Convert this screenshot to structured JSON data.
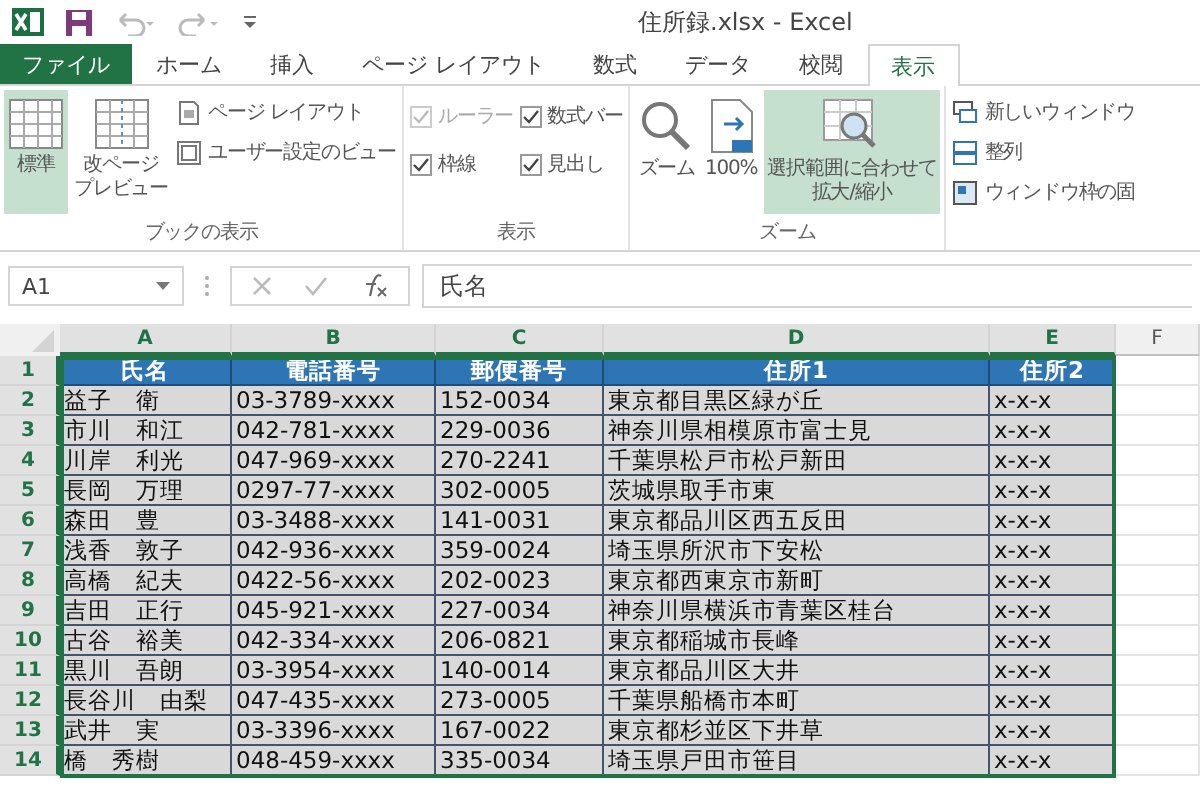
{
  "window": {
    "title": "住所録.xlsx - Excel"
  },
  "tabs": [
    {
      "label": "ファイル",
      "kind": "file",
      "selected": false
    },
    {
      "label": "ホーム",
      "kind": "tab",
      "selected": false
    },
    {
      "label": "挿入",
      "kind": "tab",
      "selected": false
    },
    {
      "label": "ページ レイアウト",
      "kind": "tab",
      "selected": false
    },
    {
      "label": "数式",
      "kind": "tab",
      "selected": false
    },
    {
      "label": "データ",
      "kind": "tab",
      "selected": false
    },
    {
      "label": "校閲",
      "kind": "tab",
      "selected": false
    },
    {
      "label": "表示",
      "kind": "tab",
      "selected": true
    }
  ],
  "ribbon": {
    "groups": [
      {
        "label": "ブックの表示",
        "columns": [
          [
            {
              "kind": "large",
              "lines": [
                "標準"
              ],
              "selected": true
            }
          ],
          [
            {
              "kind": "large",
              "lines": [
                "改ページ",
                "プレビュー"
              ],
              "selected": false
            }
          ],
          [
            {
              "kind": "small",
              "label": "ページ レイアウト",
              "selected": false
            },
            {
              "kind": "small",
              "label": "ユーザー設定のビュー",
              "selected": false
            }
          ]
        ]
      },
      {
        "label": "表示",
        "columns": [
          [
            {
              "kind": "check",
              "label": "ルーラー",
              "checked": true,
              "disabled": true
            },
            {
              "kind": "check",
              "label": "枠線",
              "checked": true,
              "disabled": false
            }
          ],
          [
            {
              "kind": "check",
              "label": "数式バー",
              "checked": true,
              "disabled": false
            },
            {
              "kind": "check",
              "label": "見出し",
              "checked": true,
              "disabled": false
            }
          ]
        ]
      },
      {
        "label": "ズーム",
        "columns": [
          [
            {
              "kind": "large",
              "lines": [
                "ズーム"
              ],
              "selected": false
            }
          ],
          [
            {
              "kind": "large",
              "lines": [
                "100%"
              ],
              "selected": false
            }
          ],
          [
            {
              "kind": "large",
              "lines": [
                "選択範囲に合わせて",
                "拡大/縮小"
              ],
              "selected": true
            }
          ]
        ]
      },
      {
        "columns": [
          [
            {
              "kind": "small",
              "label": "新しいウィンドウ",
              "selected": false
            },
            {
              "kind": "small",
              "label": "整列",
              "selected": false
            },
            {
              "kind": "small",
              "label": "ウィンドウ枠の固",
              "selected": false
            }
          ]
        ]
      }
    ]
  },
  "formula_bar": {
    "name_box": "A1",
    "value": "氏名"
  },
  "sheet": {
    "columns": [
      {
        "label": "A",
        "selected": true
      },
      {
        "label": "B",
        "selected": true
      },
      {
        "label": "C",
        "selected": true
      },
      {
        "label": "D",
        "selected": true
      },
      {
        "label": "E",
        "selected": true
      },
      {
        "label": "F",
        "selected": false
      }
    ],
    "rows": [
      {
        "number": "1",
        "selected": true,
        "kind": "header",
        "cells": [
          "氏名",
          "電話番号",
          "郵便番号",
          "住所1",
          "住所2"
        ]
      },
      {
        "number": "2",
        "selected": true,
        "kind": "data",
        "cells": [
          "益子　衛",
          "03-3789-xxxx",
          "152-0034",
          "東京都目黒区緑が丘",
          "x-x-x"
        ]
      },
      {
        "number": "3",
        "selected": true,
        "kind": "data",
        "cells": [
          "市川　和江",
          "042-781-xxxx",
          "229-0036",
          "神奈川県相模原市富士見",
          "x-x-x"
        ]
      },
      {
        "number": "4",
        "selected": true,
        "kind": "data",
        "cells": [
          "川岸　利光",
          "047-969-xxxx",
          "270-2241",
          "千葉県松戸市松戸新田",
          "x-x-x"
        ]
      },
      {
        "number": "5",
        "selected": true,
        "kind": "data",
        "cells": [
          "長岡　万理",
          "0297-77-xxxx",
          "302-0005",
          "茨城県取手市東",
          "x-x-x"
        ]
      },
      {
        "number": "6",
        "selected": true,
        "kind": "data",
        "cells": [
          "森田　豊",
          "03-3488-xxxx",
          "141-0031",
          "東京都品川区西五反田",
          "x-x-x"
        ]
      },
      {
        "number": "7",
        "selected": true,
        "kind": "data",
        "cells": [
          "浅香　敦子",
          "042-936-xxxx",
          "359-0024",
          "埼玉県所沢市下安松",
          "x-x-x"
        ]
      },
      {
        "number": "8",
        "selected": true,
        "kind": "data",
        "cells": [
          "高橋　紀夫",
          "0422-56-xxxx",
          "202-0023",
          "東京都西東京市新町",
          "x-x-x"
        ]
      },
      {
        "number": "9",
        "selected": true,
        "kind": "data",
        "cells": [
          "吉田　正行",
          "045-921-xxxx",
          "227-0034",
          "神奈川県横浜市青葉区桂台",
          "x-x-x"
        ]
      },
      {
        "number": "10",
        "selected": true,
        "kind": "data",
        "cells": [
          "古谷　裕美",
          "042-334-xxxx",
          "206-0821",
          "東京都稲城市長峰",
          "x-x-x"
        ]
      },
      {
        "number": "11",
        "selected": true,
        "kind": "data",
        "cells": [
          "黒川　吾朗",
          "03-3954-xxxx",
          "140-0014",
          "東京都品川区大井",
          "x-x-x"
        ]
      },
      {
        "number": "12",
        "selected": true,
        "kind": "data",
        "cells": [
          "長谷川　由梨",
          "047-435-xxxx",
          "273-0005",
          "千葉県船橋市本町",
          "x-x-x"
        ]
      },
      {
        "number": "13",
        "selected": true,
        "kind": "data",
        "cells": [
          "武井　実",
          "03-3396-xxxx",
          "167-0022",
          "東京都杉並区下井草",
          "x-x-x"
        ]
      },
      {
        "number": "14",
        "selected": true,
        "kind": "data",
        "cells": [
          "橋　秀樹",
          "048-459-xxxx",
          "335-0034",
          "埼玉県戸田市笹目",
          "x-x-x"
        ]
      }
    ]
  }
}
